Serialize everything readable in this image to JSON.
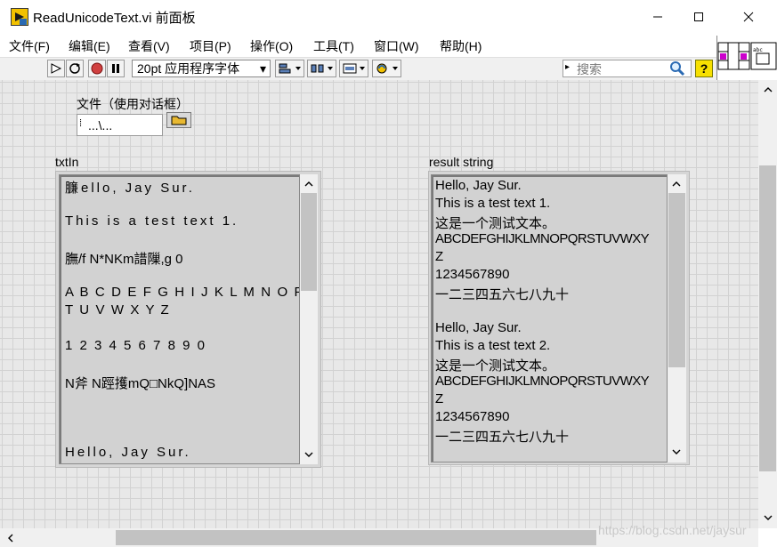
{
  "window": {
    "title": "ReadUnicodeText.vi 前面板",
    "minimize_icon": "minimize-icon",
    "maximize_icon": "maximize-icon",
    "close_icon": "close-icon"
  },
  "menu": {
    "items": [
      "文件(F)",
      "编辑(E)",
      "查看(V)",
      "项目(P)",
      "操作(O)",
      "工具(T)",
      "窗口(W)",
      "帮助(H)"
    ]
  },
  "toolbar": {
    "buttons": [
      "run-arrow-icon",
      "run-continuously-icon",
      "abort-icon",
      "pause-icon",
      "align-icon",
      "distribute-icon",
      "resize-icon",
      "reorder-icon"
    ],
    "font": "20pt 应用程序字体",
    "search_placeholder": "搜索",
    "help_icon": "help-icon"
  },
  "file_control": {
    "label": "文件（使用对话框）",
    "path_value": "...\\...",
    "browse_icon": "folder-icon"
  },
  "txtin": {
    "label": "txtIn",
    "lines": [
      " 臁ello, Jay Sur.",
      "",
      "This is a test text 1.",
      "",
      "膴/f N*NKm諎隟,g 0",
      "",
      "A B C D E F G H I J K L M N O P Q R S",
      "T U V W X Y Z",
      "",
      "1 2 3 4 5 6 7 8 9 0",
      "",
      " N斧 N踁擭mQ□NkQ]NAS",
      "",
      "",
      "",
      "Hello, Jay Sur."
    ]
  },
  "result": {
    "label": "result string",
    "lines": [
      "Hello, Jay Sur.",
      "This is a test text 1.",
      "这是一个测试文本。",
      "ABCDEFGHIJKLMNOPQRSTUVWXY",
      "Z",
      "1234567890",
      "一二三四五六七八九十",
      "",
      "Hello, Jay Sur.",
      "This is a test text 2.",
      "这是一个测试文本。",
      "ABCDEFGHIJKLMNOPQRSTUVWXY",
      "Z",
      "1234567890",
      "一二三四五六七八九十"
    ]
  },
  "watermark": "https://blog.csdn.net/jaysur"
}
